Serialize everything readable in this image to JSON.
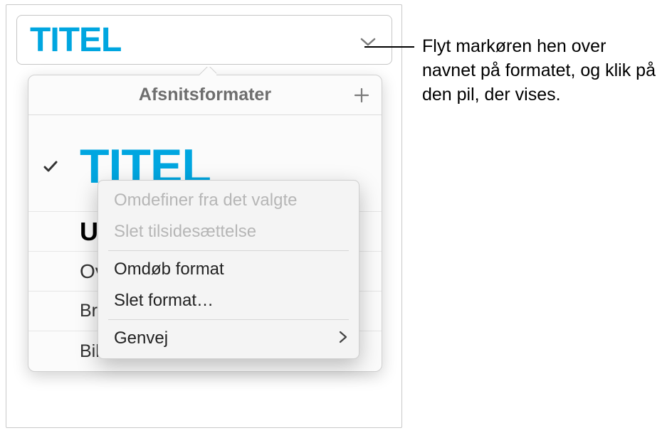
{
  "selector": {
    "current_style": "TITEL"
  },
  "popover": {
    "title": "Afsnitsformater",
    "styles": {
      "titel": "TITEL",
      "undertitel_prefix": "Un",
      "overskrift_prefix": "Ove",
      "brodtekst_prefix": "Brø",
      "billedtekst": "Billedtekst"
    }
  },
  "context_menu": {
    "redefine": "Omdefiner fra det valgte",
    "clear_override": "Slet tilsidesættelse",
    "rename": "Omdøb format",
    "delete": "Slet format…",
    "shortcut": "Genvej"
  },
  "callout": {
    "text": "Flyt markøren hen over navnet på formatet, og klik på den pil, der vises."
  }
}
